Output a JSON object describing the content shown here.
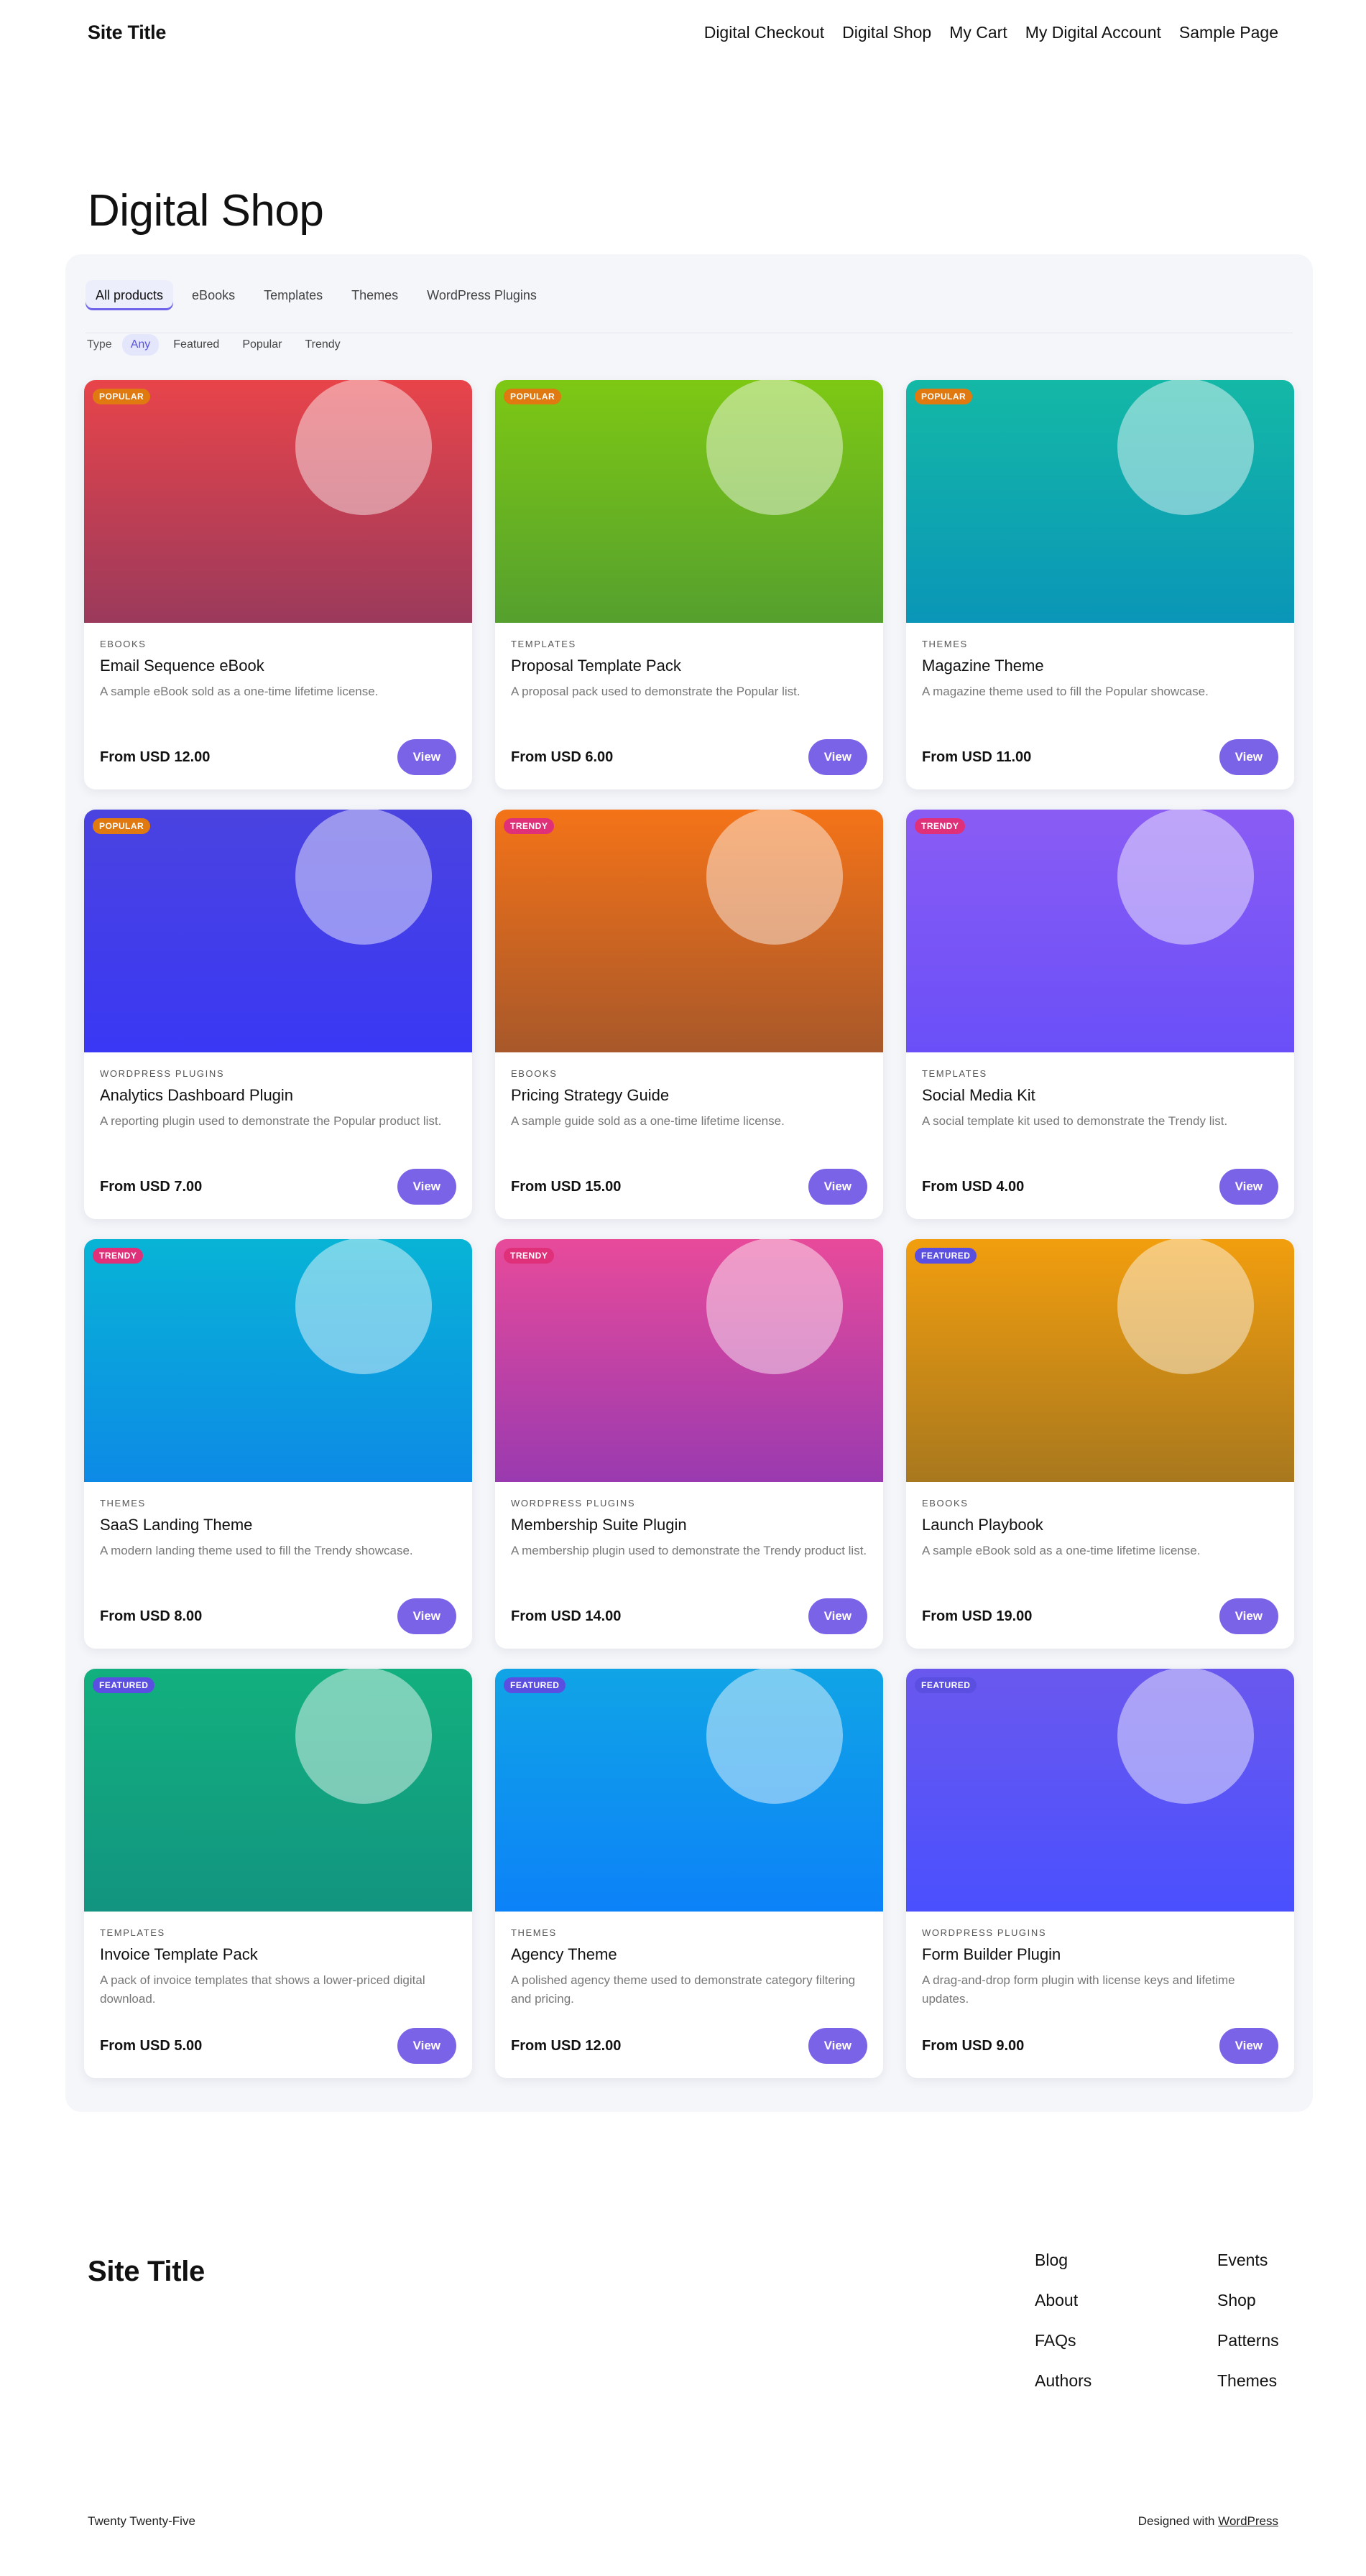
{
  "header": {
    "site_title": "Site Title",
    "nav": [
      "Digital Checkout",
      "Digital Shop",
      "My Cart",
      "My Digital Account",
      "Sample Page"
    ]
  },
  "page": {
    "title": "Digital Shop"
  },
  "filters": {
    "categories": [
      "All products",
      "eBooks",
      "Templates",
      "Themes",
      "WordPress Plugins"
    ],
    "active_category": "All products",
    "type_label": "Type",
    "types": [
      "Any",
      "Featured",
      "Popular",
      "Trendy"
    ],
    "active_type": "Any"
  },
  "colors": {
    "accent": "#7b63e8",
    "popular_badge": "#e07a10",
    "trendy_badge": "#e0307a",
    "featured_badge": "#5a4fe0"
  },
  "products": [
    {
      "badge": "POPULAR",
      "category": "EBOOKS",
      "name": "Email Sequence eBook",
      "desc": "A sample eBook sold as a one-time lifetime license.",
      "price": "From USD 12.00",
      "grad": [
        "#e8444a",
        "#9b3a5c"
      ]
    },
    {
      "badge": "POPULAR",
      "category": "TEMPLATES",
      "name": "Proposal Template Pack",
      "desc": "A proposal pack used to demonstrate the Popular list.",
      "price": "From USD 6.00",
      "grad": [
        "#7ec814",
        "#55a02e"
      ]
    },
    {
      "badge": "POPULAR",
      "category": "THEMES",
      "name": "Magazine Theme",
      "desc": "A magazine theme used to fill the Popular showcase.",
      "price": "From USD 11.00",
      "grad": [
        "#14b8a6",
        "#0a96b8"
      ]
    },
    {
      "badge": "POPULAR",
      "category": "WORDPRESS PLUGINS",
      "name": "Analytics Dashboard Plugin",
      "desc": "A reporting plugin used to demonstrate the Popular product list.",
      "price": "From USD 7.00",
      "grad": [
        "#4a43e0",
        "#3a38f4"
      ]
    },
    {
      "badge": "TRENDY",
      "category": "EBOOKS",
      "name": "Pricing Strategy Guide",
      "desc": "A sample guide sold as a one-time lifetime license.",
      "price": "From USD 15.00",
      "grad": [
        "#f47318",
        "#a8582a"
      ]
    },
    {
      "badge": "TRENDY",
      "category": "TEMPLATES",
      "name": "Social Media Kit",
      "desc": "A social template kit used to demonstrate the Trendy list.",
      "price": "From USD 4.00",
      "grad": [
        "#8a5cf4",
        "#6a4ff8"
      ]
    },
    {
      "badge": "TRENDY",
      "category": "THEMES",
      "name": "SaaS Landing Theme",
      "desc": "A modern landing theme used to fill the Trendy showcase.",
      "price": "From USD 8.00",
      "grad": [
        "#08b4d6",
        "#0d8ae6"
      ]
    },
    {
      "badge": "TRENDY",
      "category": "WORDPRESS PLUGINS",
      "name": "Membership Suite Plugin",
      "desc": "A membership plugin used to demonstrate the Trendy product list.",
      "price": "From USD 14.00",
      "grad": [
        "#e84a9a",
        "#9a3ab0"
      ]
    },
    {
      "badge": "FEATURED",
      "category": "EBOOKS",
      "name": "Launch Playbook",
      "desc": "A sample eBook sold as a one-time lifetime license.",
      "price": "From USD 19.00",
      "grad": [
        "#f29e0e",
        "#a8781e"
      ]
    },
    {
      "badge": "FEATURED",
      "category": "TEMPLATES",
      "name": "Invoice Template Pack",
      "desc": "A pack of invoice templates that shows a lower-priced digital download.",
      "price": "From USD 5.00",
      "grad": [
        "#12b07e",
        "#129480"
      ]
    },
    {
      "badge": "FEATURED",
      "category": "THEMES",
      "name": "Agency Theme",
      "desc": "A polished agency theme used to demonstrate category filtering and pricing.",
      "price": "From USD 12.00",
      "grad": [
        "#10a4e6",
        "#0c82f8"
      ]
    },
    {
      "badge": "FEATURED",
      "category": "WORDPRESS PLUGINS",
      "name": "Form Builder Plugin",
      "desc": "A drag-and-drop form plugin with license keys and lifetime updates.",
      "price": "From USD 9.00",
      "grad": [
        "#6a58ee",
        "#4a50fe"
      ]
    }
  ],
  "view_label": "View",
  "footer": {
    "site_title": "Site Title",
    "links": [
      "Blog",
      "Events",
      "About",
      "Shop",
      "FAQs",
      "Patterns",
      "Authors",
      "Themes"
    ],
    "theme_name": "Twenty Twenty-Five",
    "credit_prefix": "Designed with",
    "credit_link": "WordPress"
  }
}
